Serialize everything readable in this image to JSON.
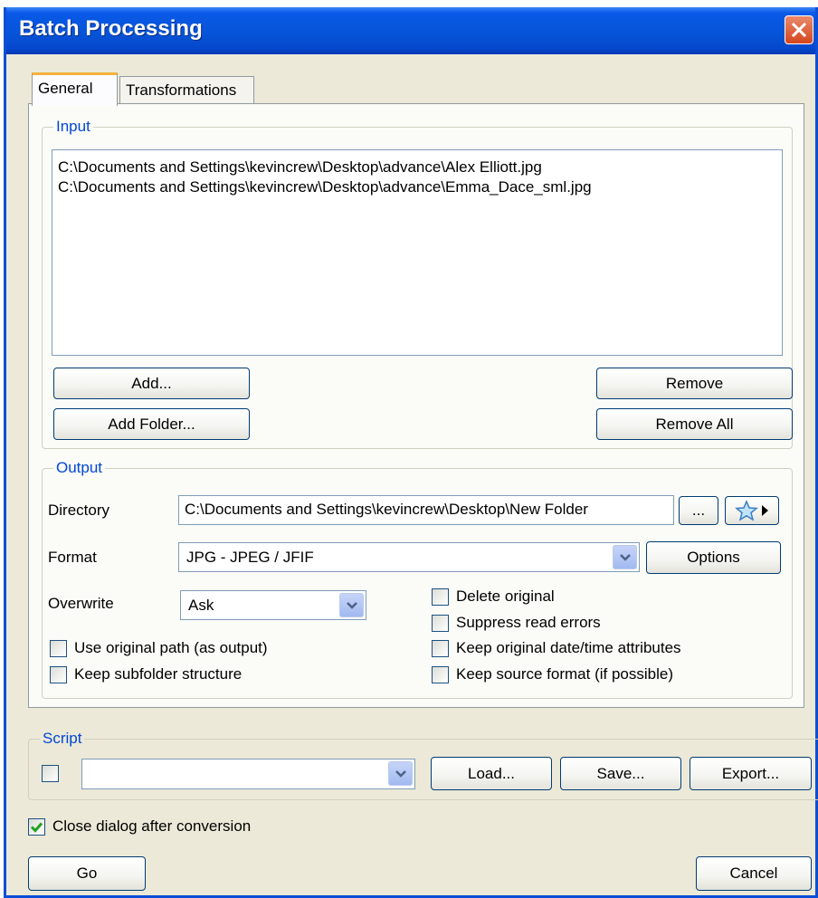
{
  "window": {
    "title": "Batch Processing"
  },
  "tabs": [
    {
      "label": "General",
      "active": true
    },
    {
      "label": "Transformations",
      "active": false
    }
  ],
  "input": {
    "legend": "Input",
    "files": [
      "C:\\Documents and Settings\\kevincrew\\Desktop\\advance\\Alex Elliott.jpg",
      "C:\\Documents and Settings\\kevincrew\\Desktop\\advance\\Emma_Dace_sml.jpg"
    ],
    "add_label": "Add...",
    "add_folder_label": "Add Folder...",
    "remove_label": "Remove",
    "remove_all_label": "Remove All"
  },
  "output": {
    "legend": "Output",
    "directory_label": "Directory",
    "directory_value": "C:\\Documents and Settings\\kevincrew\\Desktop\\New Folder",
    "browse_label": "...",
    "format_label": "Format",
    "format_value": "JPG - JPEG / JFIF",
    "options_label": "Options",
    "overwrite_label": "Overwrite",
    "overwrite_value": "Ask",
    "use_original_path": {
      "label": "Use original path (as output)",
      "checked": false
    },
    "keep_subfolder": {
      "label": "Keep subfolder structure",
      "checked": false
    },
    "delete_original": {
      "label": "Delete original",
      "checked": false
    },
    "suppress_errors": {
      "label": "Suppress read errors",
      "checked": false
    },
    "keep_date": {
      "label": "Keep original date/time attributes",
      "checked": false
    },
    "keep_format": {
      "label": "Keep source format (if possible)",
      "checked": false
    }
  },
  "script": {
    "legend": "Script",
    "enabled": false,
    "value": "",
    "load_label": "Load...",
    "save_label": "Save...",
    "export_label": "Export..."
  },
  "footer": {
    "close_after": {
      "label": "Close dialog after conversion",
      "checked": true
    },
    "go_label": "Go",
    "cancel_label": "Cancel"
  },
  "colors": {
    "title_bar": "#0654d8",
    "legend": "#0046d5",
    "tab_highlight": "#f6b23c",
    "dialog_bg": "#ece9d8"
  }
}
